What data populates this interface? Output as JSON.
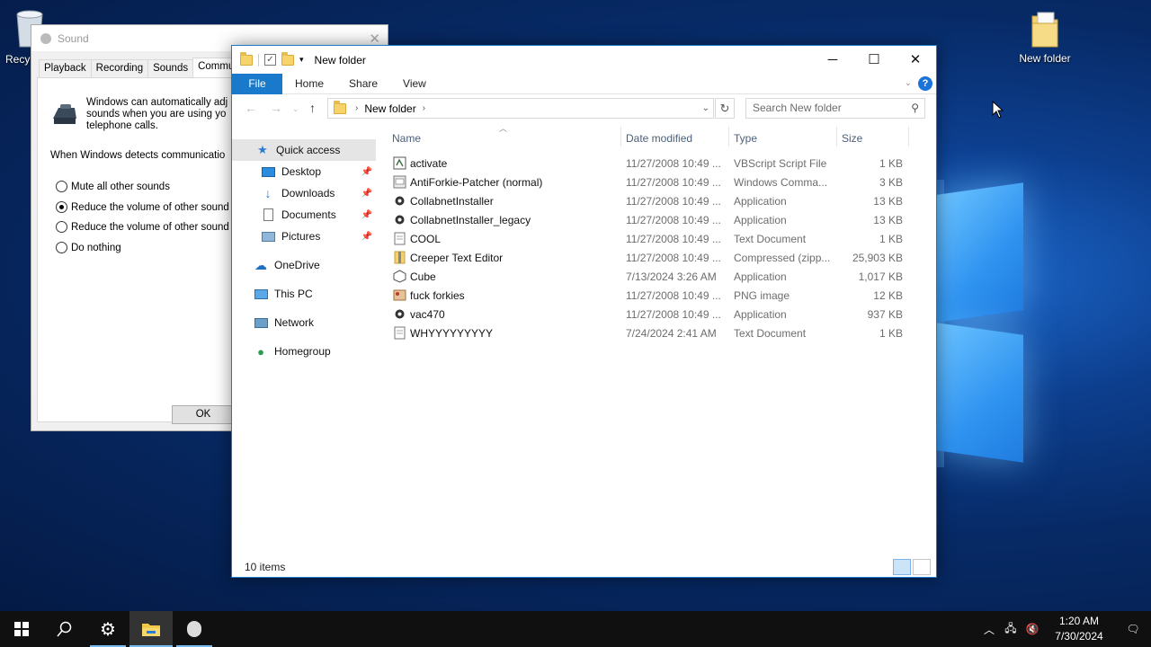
{
  "desktop": {
    "recycle_label": "Recy",
    "folder_label": "New folder"
  },
  "sound_dialog": {
    "title": "Sound",
    "tabs": [
      "Playback",
      "Recording",
      "Sounds",
      "Communic"
    ],
    "intro_lines": [
      "Windows can automatically adj",
      "sounds when you are using yo",
      "telephone calls."
    ],
    "detect_label": "When Windows detects communicatio",
    "options": [
      {
        "label": "Mute all other sounds",
        "selected": false
      },
      {
        "label": "Reduce the volume of other sound",
        "selected": true
      },
      {
        "label": "Reduce the volume of other sound",
        "selected": false
      },
      {
        "label": "Do nothing",
        "selected": false
      }
    ],
    "ok_label": "OK"
  },
  "explorer": {
    "title": "New folder",
    "ribbon_tabs": {
      "file": "File",
      "home": "Home",
      "share": "Share",
      "view": "View"
    },
    "address": "New folder",
    "search_placeholder": "Search New folder",
    "columns": {
      "name": "Name",
      "date": "Date modified",
      "type": "Type",
      "size": "Size"
    },
    "nav": {
      "quick_access": "Quick access",
      "desktop": "Desktop",
      "downloads": "Downloads",
      "documents": "Documents",
      "pictures": "Pictures",
      "onedrive": "OneDrive",
      "thispc": "This PC",
      "network": "Network",
      "homegroup": "Homegroup"
    },
    "files": [
      {
        "name": "activate",
        "date": "11/27/2008 10:49 ...",
        "type": "VBScript Script File",
        "size": "1 KB",
        "icon": "script-icon"
      },
      {
        "name": "AntiForkie-Patcher (normal)",
        "date": "11/27/2008 10:49 ...",
        "type": "Windows Comma...",
        "size": "3 KB",
        "icon": "cmd-icon"
      },
      {
        "name": "CollabnetInstaller",
        "date": "11/27/2008 10:49 ...",
        "type": "Application",
        "size": "13 KB",
        "icon": "app-icon"
      },
      {
        "name": "CollabnetInstaller_legacy",
        "date": "11/27/2008 10:49 ...",
        "type": "Application",
        "size": "13 KB",
        "icon": "app-icon"
      },
      {
        "name": "COOL",
        "date": "11/27/2008 10:49 ...",
        "type": "Text Document",
        "size": "1 KB",
        "icon": "text-icon"
      },
      {
        "name": "Creeper Text Editor",
        "date": "11/27/2008 10:49 ...",
        "type": "Compressed (zipp...",
        "size": "25,903 KB",
        "icon": "zip-icon"
      },
      {
        "name": "Cube",
        "date": "7/13/2024 3:26 AM",
        "type": "Application",
        "size": "1,017 KB",
        "icon": "cube-icon"
      },
      {
        "name": "fuck forkies",
        "date": "11/27/2008 10:49 ...",
        "type": "PNG image",
        "size": "12 KB",
        "icon": "image-icon"
      },
      {
        "name": "vac470",
        "date": "11/27/2008 10:49 ...",
        "type": "Application",
        "size": "937 KB",
        "icon": "app-icon"
      },
      {
        "name": "WHYYYYYYYYY",
        "date": "7/24/2024 2:41 AM",
        "type": "Text Document",
        "size": "1 KB",
        "icon": "text-icon"
      }
    ],
    "status": "10 items"
  },
  "taskbar": {
    "time": "1:20 AM",
    "date": "7/30/2024"
  },
  "colors": {
    "accent": "#1979ca",
    "taskbar": "#101010"
  }
}
